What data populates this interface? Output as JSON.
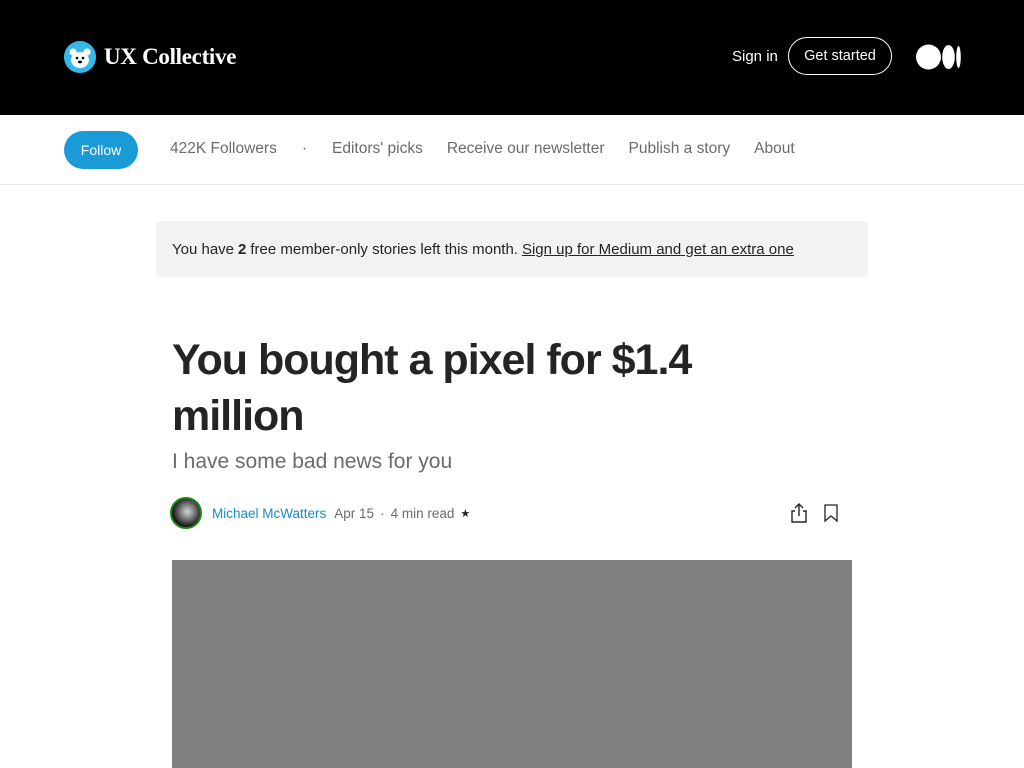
{
  "header": {
    "brand": "UX Collective",
    "sign_in": "Sign in",
    "get_started": "Get started",
    "medium_logo_icon": "medium-logo-icon"
  },
  "publication": {
    "follow": "Follow",
    "followers": "422K Followers",
    "separator": "·",
    "links": [
      "Editors' picks",
      "Receive our newsletter",
      "Publish a story",
      "About"
    ]
  },
  "banner": {
    "prefix": "You have",
    "count": "2",
    "suffix": "free member-only stories left this month.",
    "link": "Sign up for Medium and get an extra one"
  },
  "article": {
    "title": "You bought a pixel for $1.4 million",
    "subtitle": "I have some bad news for you",
    "author": "Michael McWatters",
    "date": "Apr 15",
    "read_time": "4 min read",
    "member_star": "★"
  },
  "colors": {
    "accent": "#1a9ad6",
    "header_bg": "#000000",
    "banner_bg": "#f2f2f2",
    "hero_placeholder": "#808080"
  }
}
